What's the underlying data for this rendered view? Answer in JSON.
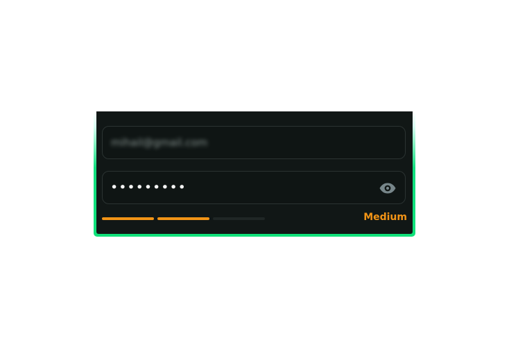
{
  "form": {
    "email_value": "mihail@gmail.com",
    "password_value": "•••••••••",
    "password_strength": {
      "label": "Medium",
      "filled_segments": 2,
      "total_segments": 3,
      "accent_color": "#f29416"
    },
    "icons": {
      "toggle_password_visibility": "eye-icon"
    },
    "colors": {
      "glow": "#11e07f",
      "panel": "#111716",
      "field_border": "#2b3332"
    }
  }
}
